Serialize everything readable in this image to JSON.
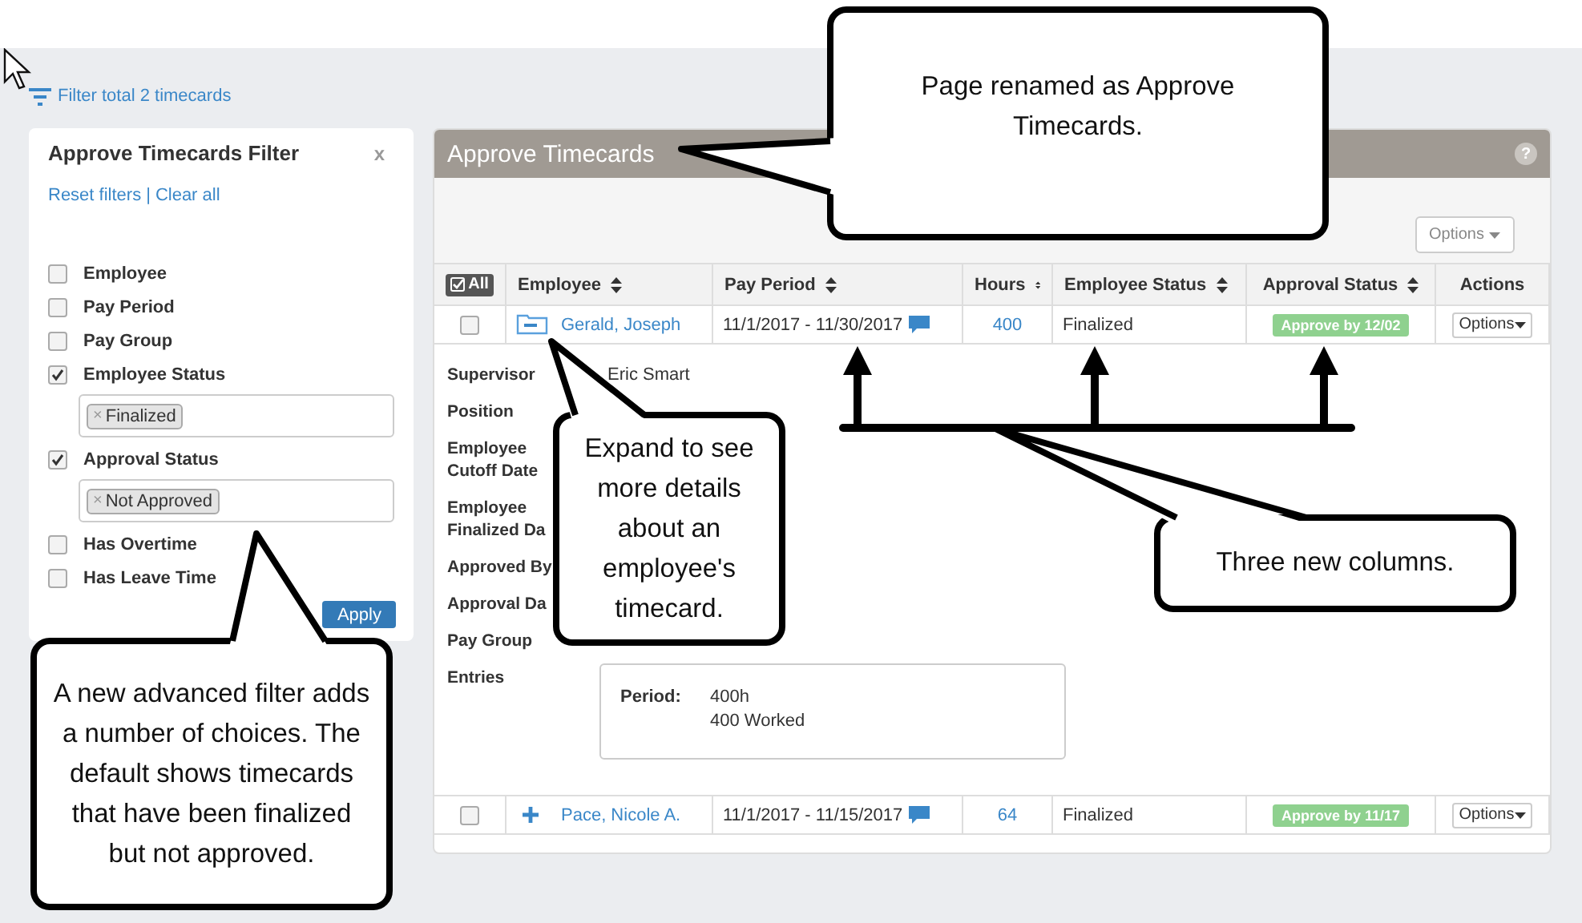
{
  "filter_link": "Filter total 2 timecards",
  "filter_panel": {
    "title": "Approve Timecards Filter",
    "close": "x",
    "links": [
      "Reset filters",
      "Clear all"
    ],
    "separator": "|",
    "options": [
      {
        "label": "Employee",
        "checked": false
      },
      {
        "label": "Pay Period",
        "checked": false
      },
      {
        "label": "Pay Group",
        "checked": false
      },
      {
        "label": "Employee Status",
        "checked": true,
        "tags": [
          {
            "remove": "×",
            "label": "Finalized"
          }
        ]
      },
      {
        "label": "Approval Status",
        "checked": true,
        "tags": [
          {
            "remove": "×",
            "label": "Not Approved"
          }
        ]
      },
      {
        "label": "Has Overtime",
        "checked": false
      },
      {
        "label": "Has Leave Time",
        "checked": false
      }
    ],
    "apply": "Apply"
  },
  "panel": {
    "title": "Approve Timecards",
    "help": "?",
    "options_button": "Options",
    "columns": [
      {
        "label": "All",
        "kind": "select_all"
      },
      {
        "label": "Employee",
        "kind": "sort"
      },
      {
        "label": "Pay Period",
        "kind": "sort"
      },
      {
        "label": "Hours",
        "kind": "sort"
      },
      {
        "label": "Employee Status",
        "kind": "sort"
      },
      {
        "label": "Approval Status",
        "kind": "sort"
      },
      {
        "label": "Actions",
        "kind": "plain"
      }
    ],
    "rows": [
      {
        "checked": false,
        "expanded": true,
        "employee": "Gerald, Joseph",
        "pay_period": "11/1/2017 - 11/30/2017",
        "hours": "400",
        "employee_status": "Finalized",
        "approval_status": "Approve by 12/02",
        "actions": "Options",
        "details": [
          {
            "label": "Supervisor",
            "value": "Eric Smart"
          },
          {
            "label": "Position"
          },
          {
            "label": "Employee Cutoff Date"
          },
          {
            "label": "Employee Finalized Da"
          },
          {
            "label": "Approved By"
          },
          {
            "label": "Approval Da"
          },
          {
            "label": "Pay Group"
          }
        ],
        "entries": {
          "label": "Entries",
          "period_label": "Period:",
          "lines": [
            "400h",
            "400 Worked"
          ]
        }
      },
      {
        "checked": false,
        "expanded": false,
        "employee": "Pace, Nicole A.",
        "pay_period": "11/1/2017 - 11/15/2017",
        "hours": "64",
        "employee_status": "Finalized",
        "approval_status": "Approve by 11/17",
        "actions": "Options"
      }
    ]
  },
  "callouts": [
    {
      "text": "Page renamed as Approve Timecards."
    },
    {
      "text": "Expand to see more details about an employee's timecard."
    },
    {
      "text": "Three new columns."
    },
    {
      "text": "A new advanced filter adds a number of choices. The default shows timecards that have been finalized but not approved."
    }
  ]
}
